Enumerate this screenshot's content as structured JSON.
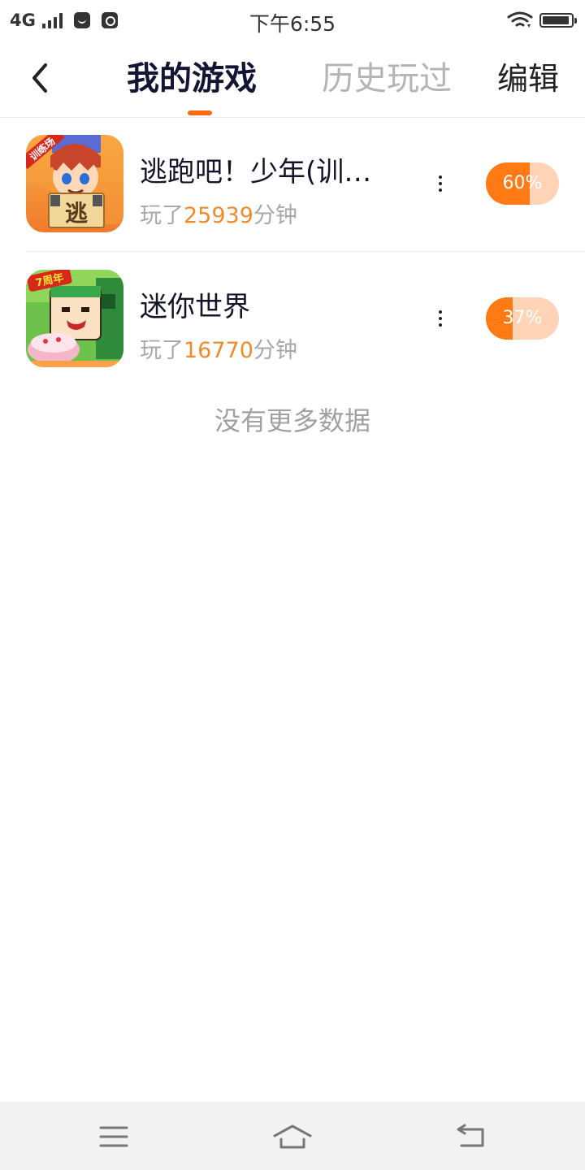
{
  "status_bar": {
    "network": "4G",
    "time": "下午6:55",
    "battery_level": 0.95,
    "icons": [
      "signal-icon",
      "notification-app-icon",
      "music-app-icon",
      "wifi-icon",
      "battery-icon"
    ]
  },
  "header": {
    "tabs": [
      {
        "label": "我的游戏",
        "active": true
      },
      {
        "label": "历史玩过",
        "active": false
      }
    ],
    "edit_label": "编辑",
    "accent_color": "#ff6a13"
  },
  "games": [
    {
      "title": "逃跑吧！少年(训…",
      "stats_prefix": "玩了",
      "minutes": "25939",
      "stats_suffix": "分钟",
      "progress_label": "60%",
      "progress": 0.6,
      "icon_text": "逃",
      "icon_badge": "训练场"
    },
    {
      "title": "迷你世界",
      "stats_prefix": "玩了",
      "minutes": "16770",
      "stats_suffix": "分钟",
      "progress_label": "37%",
      "progress": 0.37,
      "icon_badge": "7周年"
    }
  ],
  "footer_text": "没有更多数据",
  "colors": {
    "progress_fill": "#ff7a14",
    "progress_track": "#ffd3b5",
    "minutes_highlight": "#f08a2a"
  },
  "bottom_nav": [
    "menu-icon",
    "home-icon",
    "back-icon"
  ]
}
